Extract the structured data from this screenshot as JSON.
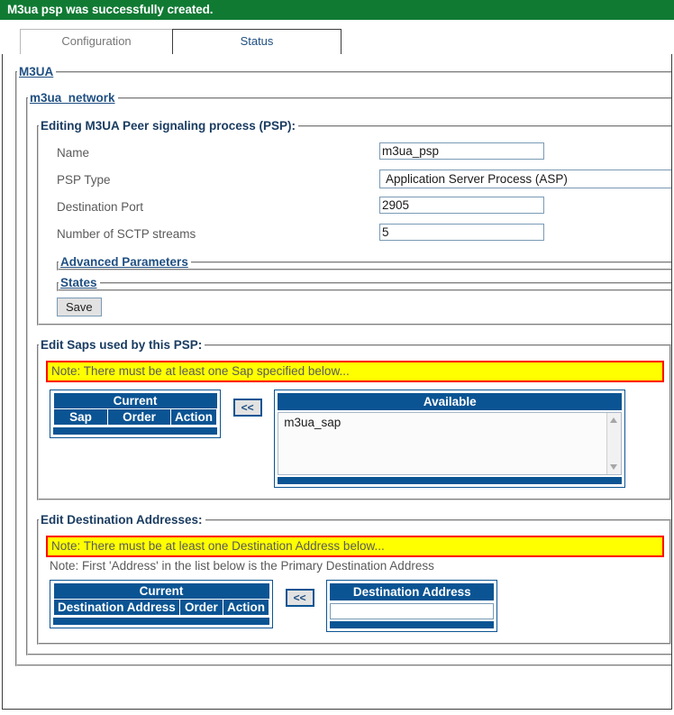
{
  "banner": {
    "message": "M3ua psp was successfully created."
  },
  "tabs": [
    {
      "label": "Configuration",
      "active": true
    },
    {
      "label": "Status",
      "active": false
    }
  ],
  "sections": {
    "m3ua": {
      "legend": "M3UA"
    },
    "network": {
      "legend": "m3ua_network"
    },
    "editing": {
      "legend": "Editing M3UA Peer signaling process (PSP):"
    },
    "advanced": {
      "legend": "Advanced Parameters"
    },
    "states": {
      "legend": "States"
    },
    "saps": {
      "legend": "Edit Saps used by this PSP:"
    },
    "destinations": {
      "legend": "Edit Destination Addresses:"
    }
  },
  "form": {
    "fields": [
      {
        "label": "Name",
        "value": "m3ua_psp",
        "type": "text"
      },
      {
        "label": "PSP Type",
        "value": "Application Server Process (ASP)",
        "type": "select"
      },
      {
        "label": "Destination Port",
        "value": "2905",
        "type": "text"
      },
      {
        "label": "Number of SCTP streams",
        "value": "5",
        "type": "text"
      }
    ],
    "save_label": "Save"
  },
  "saps": {
    "note_warning": "Note: There must be at least one Sap specified below...",
    "current_caption": "Current",
    "current_headers": [
      "Sap",
      "Order",
      "Action"
    ],
    "transfer_button": "<<",
    "available_caption": "Available",
    "available_options": [
      "m3ua_sap"
    ]
  },
  "destinations": {
    "note_warning": "Note: There must be at least one Destination Address below...",
    "note_primary": "Note: First 'Address' in the list below is the Primary Destination Address",
    "current_caption": "Current",
    "current_headers": [
      "Destination Address",
      "Order",
      "Action"
    ],
    "transfer_button": "<<",
    "address_caption": "Destination Address",
    "address_value": "",
    "address_placeholder": ""
  },
  "colors": {
    "success_green": "#107a33",
    "table_blue": "#0b5493",
    "warning_yellow": "#ffff00",
    "warning_border_red": "#ff0000",
    "legend_link": "#1f4f82"
  }
}
